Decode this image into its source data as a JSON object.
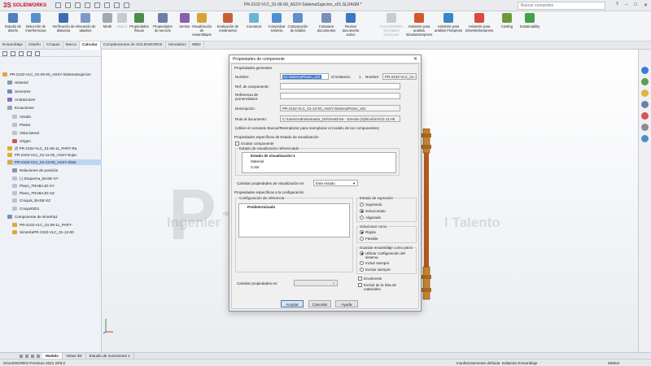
{
  "app": {
    "logo_ds": "3S",
    "logo_name": "SOLIDWORKS",
    "title": "PR-2102-VLC_01-06-00_ASSY-SistemaSujecion_x01.SLDASM *",
    "search_placeholder": "Buscar comandos"
  },
  "ribbon": {
    "buttons": [
      {
        "label": "Estudio de diseño",
        "color": "#4f7fbf"
      },
      {
        "label": "Detección de interferencias",
        "color": "#5a8fd0"
      },
      {
        "label": "Verificación de distancia",
        "color": "#3d6fb0"
      },
      {
        "label": "Alineación de taladros",
        "color": "#7d9ac4"
      },
      {
        "label": "Medir",
        "color": "#a0a8b2"
      },
      {
        "label": "Marca",
        "color": "#c6cbd2"
      },
      {
        "label": "Propiedades físicas",
        "color": "#4c8c4a"
      },
      {
        "label": "Propiedades de sección",
        "color": "#6a7fa8"
      },
      {
        "label": "Sensor",
        "color": "#8a5fb0"
      },
      {
        "label": "Visualización de ensamblajes",
        "color": "#d4a43a"
      },
      {
        "label": "Evaluación de rendimiento",
        "color": "#c95f3a"
      },
      {
        "label": "Curvatura",
        "color": "#6bb3d6"
      },
      {
        "label": "Comprobar simetría",
        "color": "#4f8ed1"
      },
      {
        "label": "Comparación de sólidos",
        "color": "#5d90c6"
      },
      {
        "label": "Comparar documentos",
        "color": "#7a8fb8"
      },
      {
        "label": "Revisar documento activo",
        "color": "#3b78c2"
      },
      {
        "label": "SOLIDWORKS Simulation Connector",
        "color": "#c7ccd3"
      },
      {
        "label": "Asistente para análisis SimulationXpress",
        "color": "#d15a2c"
      },
      {
        "label": "Asistente para análisis FloXpress",
        "color": "#3a86c8"
      },
      {
        "label": "Asistente para DriveWorksXpress",
        "color": "#d84a3c"
      },
      {
        "label": "Costing",
        "color": "#6d9a3b"
      },
      {
        "label": "Sustainability",
        "color": "#43a047"
      }
    ]
  },
  "command_tabs": [
    "Ensamblaje",
    "Diseño",
    "Croquis",
    "Marca",
    "Calcular",
    "Complementos de SOLIDWORKS",
    "Simulation",
    "MBD"
  ],
  "active_command_tab": "Calcular",
  "feature_tree": {
    "items": [
      {
        "label": "PR-2102-VLC_01-06-00_ASSY-SistemaSujecion",
        "color": "#e0a83a"
      },
      {
        "label": "Historial",
        "color": "#8b97a8"
      },
      {
        "label": "Sensores",
        "color": "#6b8fbf"
      },
      {
        "label": "Anotaciones",
        "color": "#8a6ac8"
      },
      {
        "label": "Ecuaciones",
        "color": "#9aa4b1"
      },
      {
        "label": "Alzado",
        "color": "#b9c2cf"
      },
      {
        "label": "Planta",
        "color": "#b9c2cf"
      },
      {
        "label": "Vista lateral",
        "color": "#b9c2cf"
      },
      {
        "label": "Origen",
        "color": "#c45a5a"
      },
      {
        "label": "(f) PR-2102-VLC_01-06-11_PART-Ra",
        "color": "#e0a83a"
      },
      {
        "label": "PR-2102-VLC_01-11-00_ASSY-Sujec",
        "color": "#e0a83a"
      },
      {
        "label": "PR-2102-VLC_01-12-00_ASSY-Siste",
        "color": "#e0a83a"
      },
      {
        "label": "Relaciones de posición",
        "color": "#8b97a8"
      },
      {
        "label": "(-) Esquema_BASE-XY",
        "color": "#b9c2cf"
      },
      {
        "label": "Plano_TRABAJO-XY",
        "color": "#b9c2cf"
      },
      {
        "label": "Plano_TRABAJO-XZ",
        "color": "#b9c2cf"
      },
      {
        "label": "Croquis_BASE-XZ",
        "color": "#b9c2cf"
      },
      {
        "label": "Croquis3D1",
        "color": "#b9c2cf"
      },
      {
        "label": "Componente de simetría1",
        "color": "#7a8fb8"
      },
      {
        "label": "PR-2102-VLC_01-06-11_PART-",
        "color": "#e0a83a"
      },
      {
        "label": "SimetríaPR-2102-VLC_01-12-00",
        "color": "#e0a83a"
      }
    ],
    "selected_index": 11
  },
  "dialog": {
    "title": "Propiedades de componente",
    "general_header": "Propiedades generales",
    "name_label": "Nombre:",
    "name_value": "S1-SistemaPiston_x01",
    "instance_label": "Id instancia:",
    "instance_value": "1",
    "fullname_label": "Nombre:",
    "fullname_value": "PR-2102-VLC_01-1",
    "ref_label": "Ref. de componente:",
    "bom_label": "Referencia de pomenclature:",
    "desc_label": "Descripción:",
    "desc_value": "PR-2102-VLC_01-12-00_ASSY-SistemaPiston_x01",
    "path_label": "Ruta al documento:",
    "path_value": "C:\\Users\\Administrador_DS\\OneDrive - Erende (S)\\Ecoform\\21-11-05",
    "replace_note": "(Utilice el comando Buscar/Reemplazar para reemplazar el modelo de los componentes)",
    "display_header": "Propiedades específicas de Estado de visualización",
    "hide_label": "Ocultar componente",
    "ref_state_header": "Estado de visualización referenciado",
    "display_states": [
      "Estado de visualización-1",
      "Material",
      "Color"
    ],
    "change_display_label": "Cambiar propiedades de visualización en:",
    "change_display_value": "Este estado",
    "config_header": "Propiedades específicas a la configuración",
    "ref_config_header": "Configuración de referencia",
    "configurations": [
      "Predeterminado"
    ],
    "suppress_header": "Estado de supresión",
    "suppress_options": [
      "Suprimido",
      "Solucionado",
      "Aligerado"
    ],
    "suppress_selected": 1,
    "solve_header": "Solucionar como",
    "solve_options": [
      "Rígido",
      "Flexible"
    ],
    "solve_selected": 0,
    "save_header": "Guardar ensamblaje como pieza",
    "save_options": [
      "Utilizar configuración del sistema",
      "Incluir siempre",
      "Excluir siempre"
    ],
    "save_selected": 0,
    "envelope_label": "Envolvente",
    "exclude_bom_label": "Excluir de la lista de materiales",
    "change_props_label": "Cambiar propiedades en:",
    "ok": "Aceptar",
    "cancel": "Cancelar",
    "help": "Ayuda"
  },
  "watermark": {
    "left": "Ingenier",
    "right": "l Talento"
  },
  "bottom_tabs": [
    "Modelo",
    "Vistas 3D",
    "Estudio de movimiento 1"
  ],
  "active_bottom_tab": "Modelo",
  "status": {
    "left": "SOLIDWORKS Premium 2021 SP5.0",
    "state": "Insuficientemente definida",
    "mode": "Editando Ensamblaje",
    "units": "MMGS"
  }
}
